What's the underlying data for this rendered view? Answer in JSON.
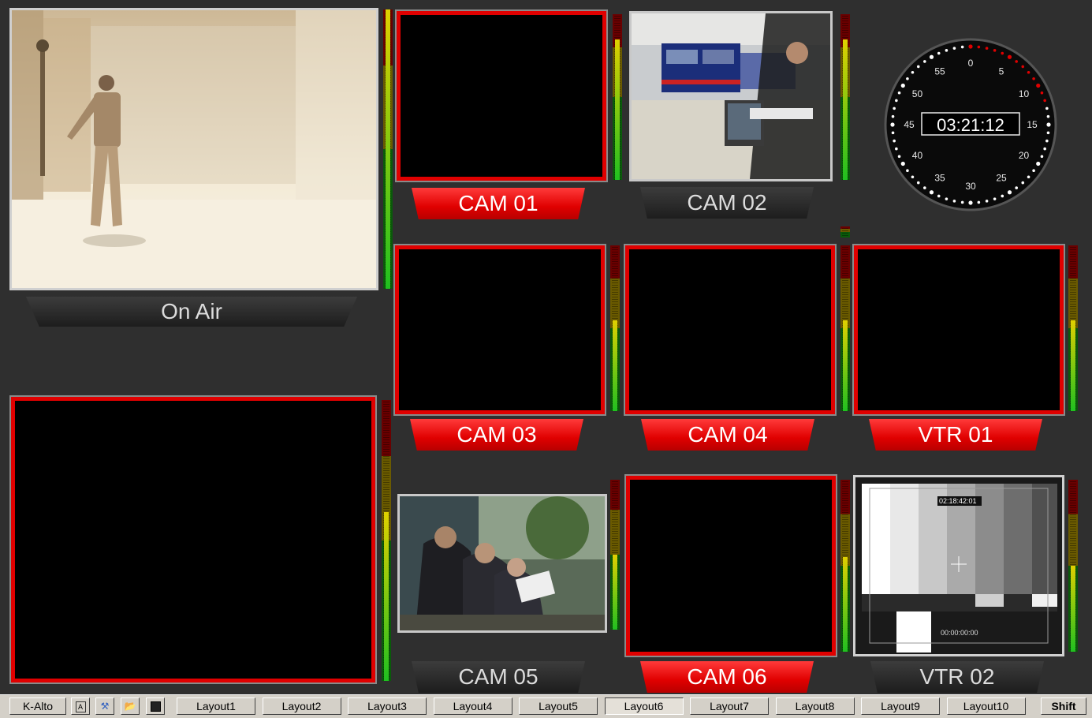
{
  "monitors": {
    "on_air": {
      "label": "On Air"
    },
    "cam01": {
      "label": "CAM 01",
      "tally": "red"
    },
    "cam02": {
      "label": "CAM 02",
      "tally": "off"
    },
    "cam03": {
      "label": "CAM 03",
      "tally": "red"
    },
    "cam04": {
      "label": "CAM 04",
      "tally": "red"
    },
    "vtr01": {
      "label": "VTR 01",
      "tally": "red"
    },
    "cam05": {
      "label": "CAM 05",
      "tally": "off"
    },
    "cam06": {
      "label": "CAM 06",
      "tally": "red"
    },
    "vtr02": {
      "label": "VTR 02",
      "tally": "off",
      "timecode_top": "02:18:42:01",
      "timecode_bottom": "00:00:00:00"
    }
  },
  "clock": {
    "time": "03:21:12",
    "numerals": [
      "0",
      "5",
      "10",
      "15",
      "20",
      "25",
      "30",
      "35",
      "40",
      "45",
      "50",
      "55"
    ]
  },
  "colors": {
    "tally_red": "#e00000",
    "background": "#2f2f2f"
  },
  "toolbar": {
    "app_button": "K-Alto",
    "icons": [
      "text-icon",
      "wrench-icon",
      "open-folder-icon",
      "save-icon"
    ],
    "layouts": [
      "Layout1",
      "Layout2",
      "Layout3",
      "Layout4",
      "Layout5",
      "Layout6",
      "Layout7",
      "Layout8",
      "Layout9",
      "Layout10"
    ],
    "active_layout": "Layout6",
    "shift": "Shift"
  }
}
